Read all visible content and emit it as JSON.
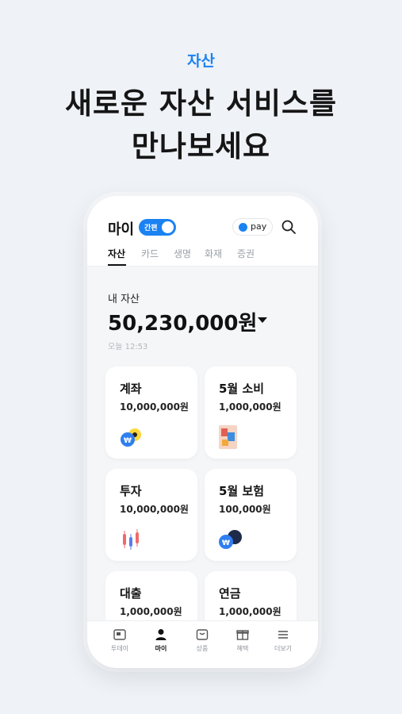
{
  "promo": {
    "eyebrow": "자산",
    "headline_line1": "새로운 자산 서비스를",
    "headline_line2": "만나보세요"
  },
  "header": {
    "title": "마이",
    "toggle_label": "간편",
    "pay_label": "pay"
  },
  "tabs": [
    "자산",
    "카드",
    "생명",
    "화재",
    "증권"
  ],
  "asset": {
    "label": "내 자산",
    "amount": "50,230,000원",
    "time": "오늘 12:53"
  },
  "cards": [
    {
      "title": "계좌",
      "value": "10,000,000원",
      "icon": "bank-coin-icon"
    },
    {
      "title": "5월 소비",
      "value": "1,000,000원",
      "icon": "card-icon"
    },
    {
      "title": "투자",
      "value": "10,000,000원",
      "icon": "candlestick-icon"
    },
    {
      "title": "5월 보험",
      "value": "100,000원",
      "icon": "insurance-icon"
    },
    {
      "title": "대출",
      "value": "1,000,000원",
      "icon": "loan-icon"
    },
    {
      "title": "연금",
      "value": "1,000,000원",
      "icon": "pension-icon"
    }
  ],
  "nav": [
    {
      "label": "투데이",
      "icon": "today-icon"
    },
    {
      "label": "마이",
      "icon": "person-icon"
    },
    {
      "label": "상품",
      "icon": "product-icon"
    },
    {
      "label": "혜택",
      "icon": "gift-icon"
    },
    {
      "label": "더보기",
      "icon": "menu-icon"
    }
  ],
  "colors": {
    "accent": "#1b82f2",
    "background": "#eff2f6",
    "card": "#ffffff"
  }
}
